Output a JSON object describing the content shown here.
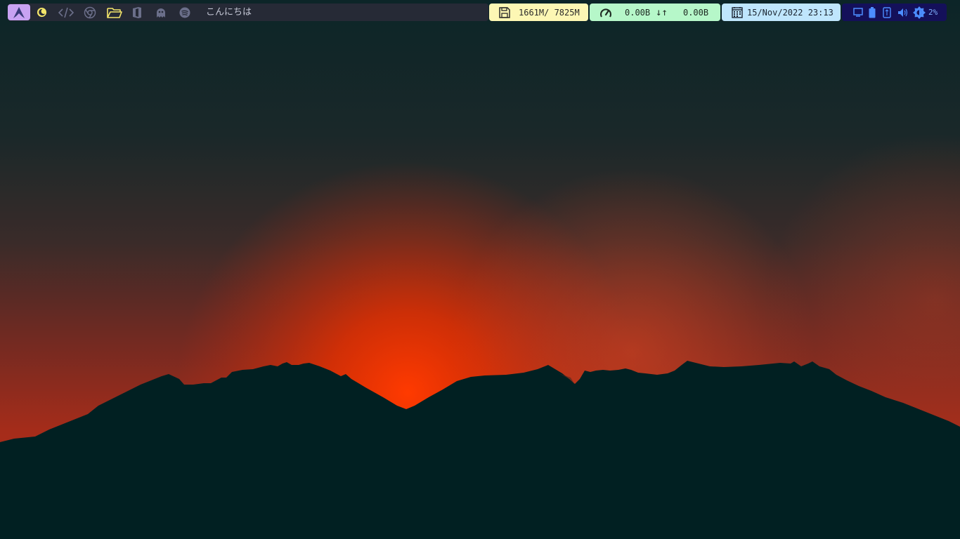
{
  "desktop": {
    "wallpaper": "mountain silhouette at sunset",
    "sky_colors": [
      "#0e2628",
      "#2c2d2e",
      "#c62f12",
      "#e83400"
    ],
    "mountain_color": "#002022"
  },
  "bar": {
    "workspaces": [
      {
        "icon": "arch-logo-icon",
        "active": true
      },
      {
        "icon": "moon-icon"
      },
      {
        "icon": "code-icon"
      },
      {
        "icon": "browser-icon"
      },
      {
        "icon": "folder-icon"
      },
      {
        "icon": "office-icon"
      },
      {
        "icon": "ghost-icon"
      },
      {
        "icon": "spotify-icon"
      }
    ],
    "window_title": "こんにちは",
    "memory": {
      "icon": "floppy-disk-icon",
      "text": "1661M/ 7825M"
    },
    "network": {
      "icon": "speedometer-icon",
      "down": "0.00B",
      "arrows": "↓↑",
      "up": "0.00B"
    },
    "clock": {
      "icon": "calendar-icon",
      "text": "15/Nov/2022 23:13"
    },
    "tray": {
      "icons": [
        "monitor-icon",
        "battery-icon",
        "usb-drive-icon",
        "volume-icon",
        "brightness-icon"
      ],
      "brightness": "2%"
    },
    "colors": {
      "accent": "#c8a2f2",
      "memory_bg": "#fdf7b4",
      "network_bg": "#b6f7c9",
      "clock_bg": "#bfe6fd",
      "tray_bg": "#14105a"
    }
  }
}
